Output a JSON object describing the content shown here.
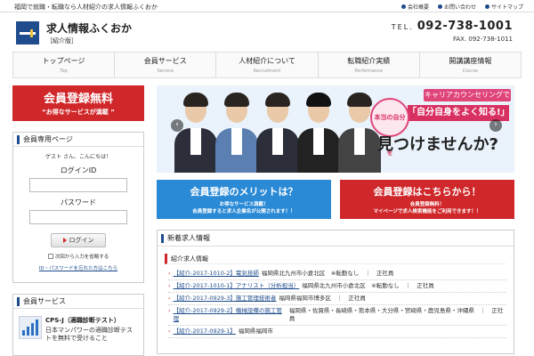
{
  "topbar": {
    "tagline": "福岡で就職・転職なら人材紹介の求人情報ふくおか",
    "links": [
      "会社概要",
      "お問い合わせ",
      "サイトマップ"
    ]
  },
  "header": {
    "title": "求人情報ふくおか",
    "subtitle": "［紹介版］",
    "tel_label": "TEL.",
    "tel": "092-738-1001",
    "fax": "FAX. 092-738-1011"
  },
  "nav": [
    {
      "jp": "トップページ",
      "en": "Top"
    },
    {
      "jp": "会員サービス",
      "en": "Service"
    },
    {
      "jp": "人材紹介について",
      "en": "Recruitment"
    },
    {
      "jp": "転職紹介実績",
      "en": "Performance"
    },
    {
      "jp": "開講講座情報",
      "en": "Course"
    }
  ],
  "sidebar": {
    "register_banner": {
      "title": "会員登録無料",
      "subtitle": "“お得なサービスが満載 ”"
    },
    "member_box": {
      "heading": "会員専用ページ",
      "greeting": "ゲスト さん、こんにちは！",
      "login_id_label": "ログインID",
      "password_label": "パスワード",
      "login_button": "ログイン",
      "remember_label": "次回から入力を省略する",
      "forgot_link": "ID・パスワードを忘れた方はこちら"
    },
    "service_box": {
      "heading": "会員サービス",
      "item_title": "CPS-J（適職診断テスト）",
      "item_desc": "日本マンパワーの適職診断テストを無料で受けること"
    }
  },
  "slider": {
    "copy_top": "キャリアカウンセリングで",
    "copy_main": "「自分自身をよく知る!」",
    "circle_text": "本当の自分を",
    "big_text": "見つけませんか?",
    "prev": "‹",
    "next": "›"
  },
  "cta": {
    "merit": {
      "title": "会員登録のメリットは？",
      "line1": "お得なサービス満載！",
      "line2": "会員登録すると求人企業名が公開されます！！"
    },
    "register": {
      "title": "会員登録はこちらから！",
      "line1": "会員登録無料！",
      "line2": "マイページで求人検索機能をご利用できます！！"
    }
  },
  "news": {
    "heading": "新着求人情報",
    "subheading": "紹介求人情報",
    "rows": [
      {
        "link": "【紹介-2017-1010-2】電気技師",
        "rest": "福岡県北九州市小倉北区　※転勤なし　｜　正社員"
      },
      {
        "link": "【紹介-2017-1010-1】アナリスト（分析担当）",
        "rest": "福岡県北九州市小倉北区　※転勤なし　｜　正社員"
      },
      {
        "link": "【紹介-2017-0929-3】施工管理技術者",
        "rest": "福岡県福岡市博多区　｜　正社員"
      },
      {
        "link": "【紹介-2017-0929-2】機械設備の施工管理",
        "rest": "福岡県・佐賀県・長崎県・熊本県・大分県・宮崎県・鹿児島県・沖縄県　｜　正社員"
      },
      {
        "link": "【紹介-2017-0929-1】",
        "rest": "福岡県福岡市"
      }
    ]
  },
  "colors": {
    "brand": "#1e4c8c",
    "red": "#d0272a",
    "blue": "#2a8ad6",
    "pink": "#d93062"
  }
}
